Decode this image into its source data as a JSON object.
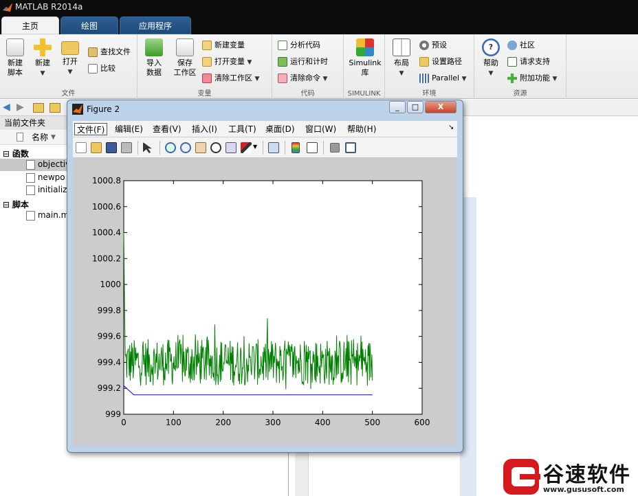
{
  "window": {
    "title": "MATLAB R2014a"
  },
  "tabs": [
    {
      "label": "主页"
    },
    {
      "label": "绘图"
    },
    {
      "label": "应用程序"
    }
  ],
  "ribbon": {
    "file": {
      "name": "文件",
      "new_script": "新建\n脚本",
      "new": "新建",
      "open": "打开",
      "find_files": "查找文件",
      "compare": "比较"
    },
    "variable": {
      "name": "变量",
      "import": "导入\n数据",
      "save_ws": "保存\n工作区",
      "new_var": "新建变量",
      "open_var": "打开变量",
      "clear_ws": "清除工作区"
    },
    "code": {
      "name": "代码",
      "analyze": "分析代码",
      "run_time": "运行和计时",
      "clear_cmd": "清除命令"
    },
    "simulink": {
      "name": "SIMULINK",
      "lib": "Simulink\n库"
    },
    "env": {
      "name": "环境",
      "layout": "布局",
      "prefs": "预设",
      "set_path": "设置路径",
      "parallel": "Parallel"
    },
    "resources": {
      "name": "资源",
      "help": "帮助",
      "community": "社区",
      "support": "请求支持",
      "addons": "附加功能"
    }
  },
  "left_panel": {
    "title": "当前文件夹",
    "column": "名称",
    "groups": [
      {
        "label": "函数",
        "files": [
          "objectiv",
          "newpo",
          "initializ"
        ]
      },
      {
        "label": "脚本",
        "files": [
          "main.m"
        ]
      }
    ]
  },
  "figure": {
    "title": "Figure 2",
    "menu": [
      "文件(F)",
      "编辑(E)",
      "查看(V)",
      "插入(I)",
      "工具(T)",
      "桌面(D)",
      "窗口(W)",
      "帮助(H)"
    ],
    "min": "_",
    "max": "□",
    "close": "X"
  },
  "chart_data": {
    "type": "line",
    "xlim": [
      0,
      600
    ],
    "ylim": [
      999,
      1000.8
    ],
    "x_ticks": [
      0,
      100,
      200,
      300,
      400,
      500,
      600
    ],
    "y_ticks": [
      999,
      999.2,
      999.4,
      999.6,
      999.8,
      1000,
      1000.2,
      1000.4,
      1000.6,
      1000.8
    ],
    "y_tick_labels": [
      "999",
      "999.2",
      "999.4",
      "999.6",
      "999.8",
      "1000",
      "1000.2",
      "1000.4",
      "1000.6",
      "1000.8"
    ],
    "grid": false,
    "series": [
      {
        "color": "#008000",
        "x_range": [
          0,
          500
        ],
        "start_value": 1000.4,
        "settle_value": 999.4,
        "min": 999.15,
        "max": 999.74
      },
      {
        "color": "#0000cc",
        "x_range": [
          0,
          500
        ],
        "start_value": 999.22,
        "settle_value": 999.15
      }
    ]
  },
  "watermark": {
    "brand": "谷速软件",
    "url": "www.gususoft.com",
    "accent": "#d6191c"
  }
}
